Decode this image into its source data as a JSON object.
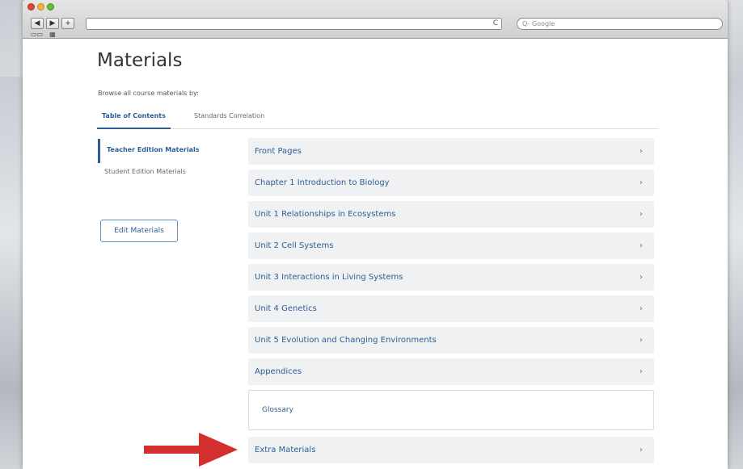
{
  "browser": {
    "nav_back": "◀",
    "nav_forward": "▶",
    "nav_add": "+",
    "url": "",
    "reload": "C",
    "search_placeholder": "Q- Google",
    "bookmark_icons": [
      "book-icon",
      "grid-icon"
    ]
  },
  "page": {
    "title": "Materials",
    "browse_text": "Browse all course materials by:"
  },
  "tabs": [
    {
      "label": "Table of Contents",
      "active": true
    },
    {
      "label": "Standards Correlation",
      "active": false
    }
  ],
  "sidebar": {
    "items": [
      {
        "label": "Teacher Edition Materials",
        "active": true
      },
      {
        "label": "Student Edition Materials",
        "active": false
      }
    ],
    "edit_button": "Edit Materials"
  },
  "list": {
    "rows": [
      {
        "label": "Front Pages"
      },
      {
        "label": "Chapter 1 Introduction to Biology"
      },
      {
        "label": "Unit 1 Relationships in Ecosystems"
      },
      {
        "label": "Unit 2 Cell Systems"
      },
      {
        "label": "Unit 3 Interactions in Living Systems"
      },
      {
        "label": "Unit 4 Genetics"
      },
      {
        "label": "Unit 5 Evolution and Changing Environments"
      },
      {
        "label": "Appendices"
      }
    ],
    "sub_item": "Glossary",
    "last_row": "Extra Materials",
    "chevron": "›"
  },
  "colors": {
    "accent": "#2b5e93",
    "annotation_arrow": "#d32f2f"
  }
}
